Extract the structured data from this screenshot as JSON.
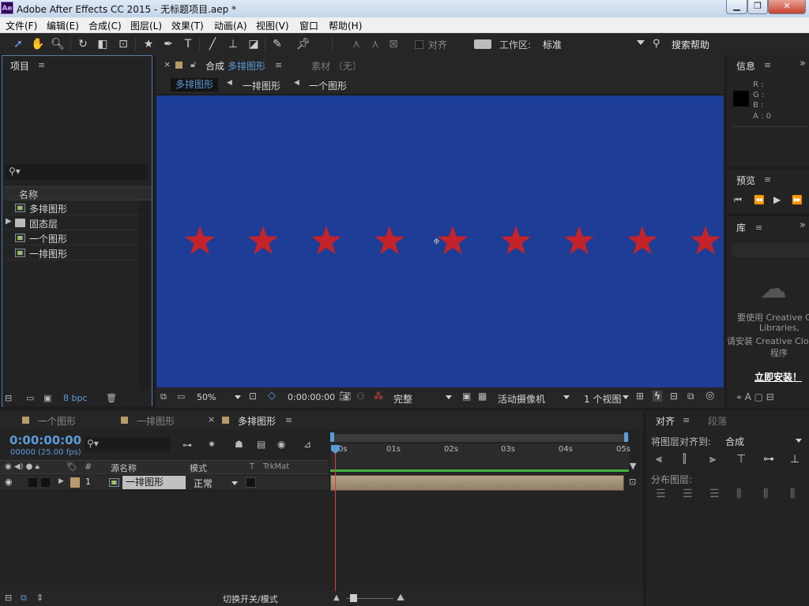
{
  "window": {
    "logo": "Ae",
    "title": "Adobe After Effects CC 2015 - 无标题项目.aep *",
    "min": "▁",
    "max": "❐",
    "close": "✕"
  },
  "menu": [
    "文件(F)",
    "编辑(E)",
    "合成(C)",
    "图层(L)",
    "效果(T)",
    "动画(A)",
    "视图(V)",
    "窗口",
    "帮助(H)"
  ],
  "toolbar": {
    "snap_label": "对齐",
    "workspace_label": "工作区:",
    "workspace_value": "标准",
    "search_help": "搜索帮助"
  },
  "project": {
    "title": "项目",
    "menu": "≡",
    "column_name": "名称",
    "items": [
      {
        "label": "多排图形",
        "type": "comp"
      },
      {
        "label": "固态层",
        "type": "folder"
      },
      {
        "label": "一个图形",
        "type": "comp"
      },
      {
        "label": "一排图形",
        "type": "comp"
      }
    ],
    "bpc": "8 bpc"
  },
  "composition": {
    "tab_label": "合成",
    "tab_name": "多排图形",
    "footage_tab": "素材 （无）",
    "menu": "≡",
    "breadcrumbs": [
      "多排图形",
      "一排图形",
      "一个图形"
    ],
    "stars": 9,
    "star_color": "#c42329",
    "bg_color": "#1d3d96",
    "zoom": "50%",
    "timecode": "0:00:00:00",
    "resolution": "完整",
    "camera": "活动摄像机",
    "views": "1 个视图"
  },
  "info": {
    "title": "信息",
    "menu": "≡",
    "r": "R :",
    "g": "G :",
    "b": "B :",
    "a": "A : 0"
  },
  "preview": {
    "title": "预览",
    "menu": "≡"
  },
  "library": {
    "title": "库",
    "menu": "≡",
    "message1": "要使用 Creative Cl",
    "message2": "Libraries,",
    "message3": "请安装 Creative Clou",
    "message4": "程序",
    "install": "立即安装！"
  },
  "timeline": {
    "tabs": [
      "一个图形",
      "一排图形",
      "多排图形"
    ],
    "menu": "≡",
    "timecode": "0:00:00:00",
    "fps": "00000 (25.00 fps)",
    "col_num": "#",
    "col_source": "源名称",
    "col_mode": "模式",
    "col_t": "T",
    "col_trkmat": "TrkMat",
    "ruler": [
      "0s",
      "01s",
      "02s",
      "03s",
      "04s",
      "05s"
    ],
    "layer": {
      "index": "1",
      "name": "一排图形",
      "mode": "正常"
    },
    "switch_mode": "切换开关/模式"
  },
  "align": {
    "title": "对齐",
    "menu": "≡",
    "paragraph": "段落",
    "align_to_label": "将图层对齐到:",
    "align_to_value": "合成",
    "distribute_label": "分布图层:"
  }
}
